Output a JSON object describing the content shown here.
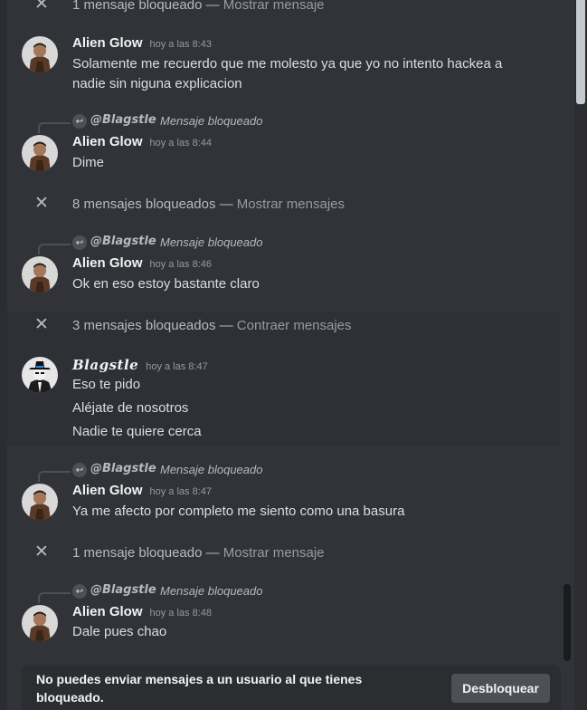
{
  "blocked_rows": [
    {
      "count_text": "1 mensaje bloqueado",
      "action_text": "Mostrar mensaje"
    },
    {
      "count_text": "8 mensajes bloqueados",
      "action_text": "Mostrar mensajes"
    },
    {
      "count_text": "3 mensajes bloqueados",
      "action_text": "Contraer mensajes"
    },
    {
      "count_text": "1 mensaje bloqueado",
      "action_text": "Mostrar mensaje"
    }
  ],
  "separator": " — ",
  "close_glyph": "✕",
  "reply_glyph": "↩",
  "messages": [
    {
      "author": "Alien Glow",
      "time": "hoy a las 8:43",
      "lines": [
        "Solamente me recuerdo que me molesto ya que yo no intento hackea a",
        "nadie sin niguna explicacion"
      ]
    },
    {
      "reply": {
        "name": "@Blagstle",
        "text": "Mensaje bloqueado"
      },
      "author": "Alien Glow",
      "time": "hoy a las 8:44",
      "lines": [
        "Dime"
      ]
    },
    {
      "reply": {
        "name": "@Blagstle",
        "text": "Mensaje bloqueado"
      },
      "author": "Alien Glow",
      "time": "hoy a las 8:46",
      "lines": [
        "Ok en eso estoy bastante claro"
      ]
    },
    {
      "author": "Blagstle",
      "time": "hoy a las 8:47",
      "lines": [
        "Eso te pido",
        "Aléjate de nosotros",
        "Nadie te quiere cerca"
      ]
    },
    {
      "reply": {
        "name": "@Blagstle",
        "text": "Mensaje bloqueado"
      },
      "author": "Alien Glow",
      "time": "hoy a las 8:47",
      "lines": [
        "Ya me afecto por  completo me siento como una basura"
      ]
    },
    {
      "reply": {
        "name": "@Blagstle",
        "text": "Mensaje bloqueado"
      },
      "author": "Alien Glow",
      "time": "hoy a las 8:48",
      "lines": [
        "Dale pues chao"
      ]
    }
  ],
  "footer": {
    "notice": "No puedes enviar mensajes a un usuario al que tienes bloqueado.",
    "unblock_button": "Desbloquear"
  },
  "colors": {
    "background": "#313338",
    "author": "#f2f3f5",
    "muted": "#949ba4",
    "button": "#4e5058"
  },
  "icons": {
    "alien_avatar": "avatar-alien-glow",
    "blagstle_avatar": "avatar-blagstle",
    "close": "close-icon",
    "reply": "reply-arrow-icon"
  }
}
